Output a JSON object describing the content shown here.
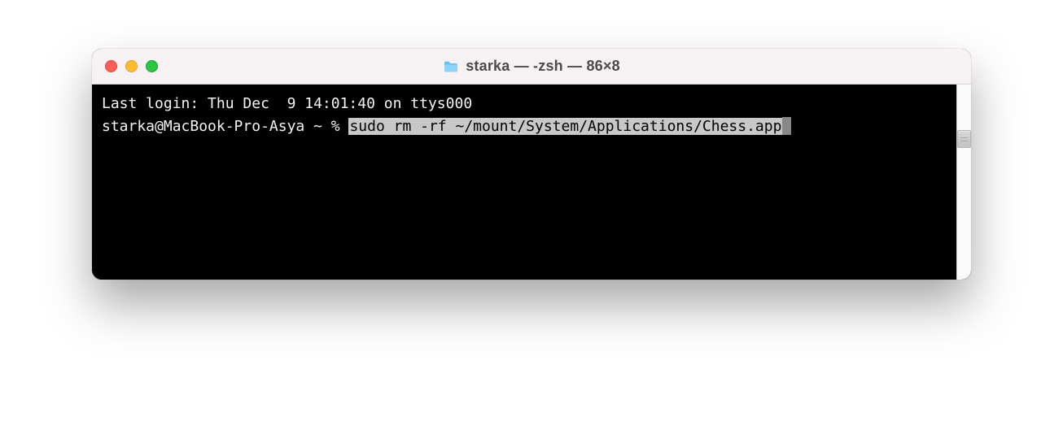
{
  "window": {
    "title": "starka — -zsh — 86×8"
  },
  "terminal": {
    "last_login": "Last login: Thu Dec  9 14:01:40 on ttys000",
    "prompt": "starka@MacBook-Pro-Asya ~ % ",
    "command": "sudo rm -rf ~/mount/System/Applications/Chess.app"
  }
}
